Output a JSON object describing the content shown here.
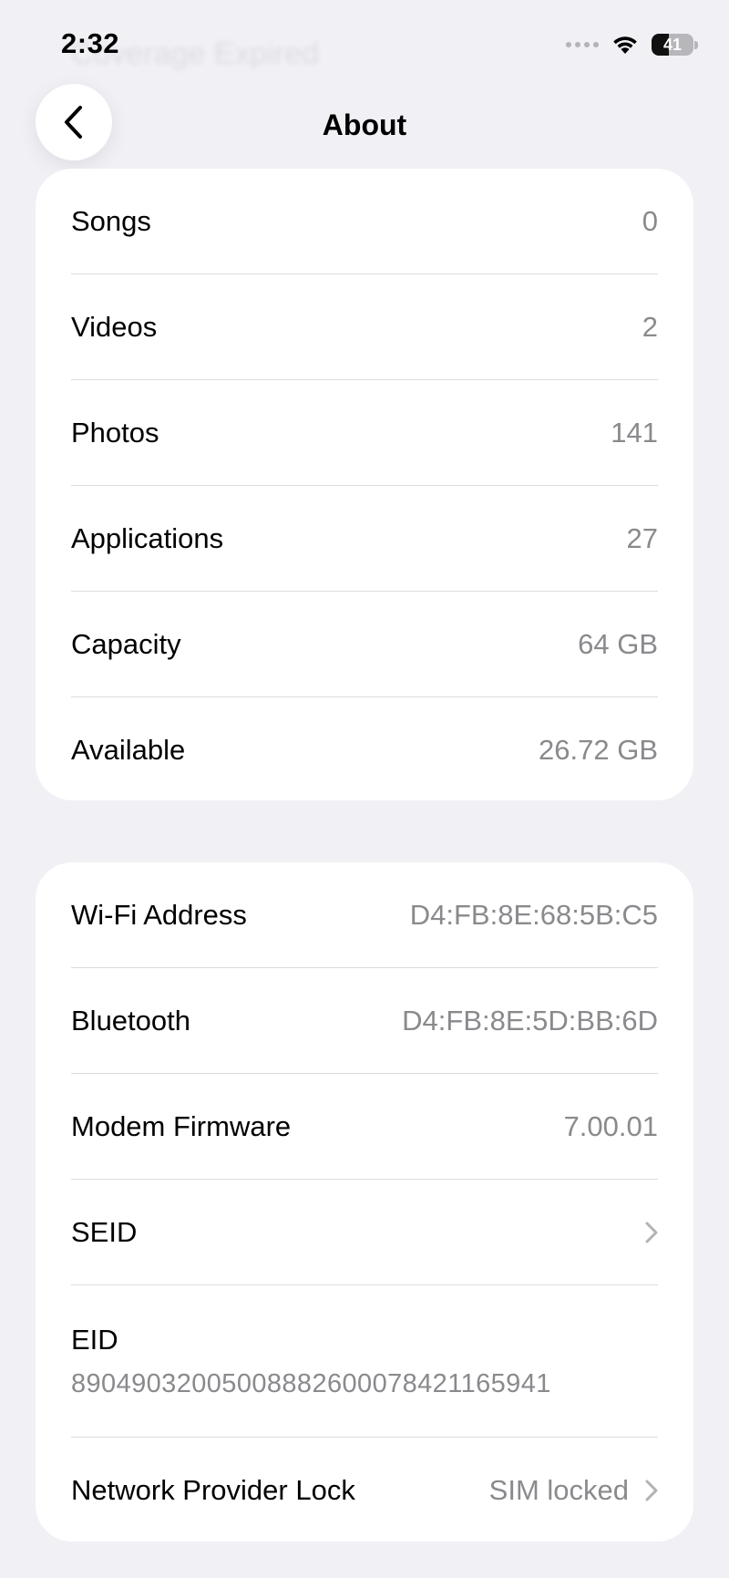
{
  "status_bar": {
    "time": "2:32",
    "battery_level": "41",
    "ghost_text": "Coverage Expired",
    "icons": [
      "cellular-signal-icon",
      "wifi-icon",
      "battery-icon"
    ]
  },
  "nav": {
    "title": "About",
    "back_icon": "chevron-left-icon"
  },
  "media_section": {
    "rows": [
      {
        "label": "Songs",
        "value": "0"
      },
      {
        "label": "Videos",
        "value": "2"
      },
      {
        "label": "Photos",
        "value": "141"
      },
      {
        "label": "Applications",
        "value": "27"
      },
      {
        "label": "Capacity",
        "value": "64 GB"
      },
      {
        "label": "Available",
        "value": "26.72 GB"
      }
    ]
  },
  "network_section": {
    "rows": [
      {
        "label": "Wi-Fi Address",
        "value": "D4:FB:8E:68:5B:C5"
      },
      {
        "label": "Bluetooth",
        "value": "D4:FB:8E:5D:BB:6D"
      },
      {
        "label": "Modem Firmware",
        "value": "7.00.01"
      },
      {
        "label": "SEID",
        "value": ""
      },
      {
        "label": "EID",
        "value": "89049032005008882600078421165941"
      },
      {
        "label": "Network Provider Lock",
        "value": "SIM locked"
      }
    ]
  },
  "colors": {
    "background": "#f0f0f5",
    "card": "#ffffff",
    "secondary_text": "#8a8a8e",
    "separator": "#dcdcdf"
  }
}
